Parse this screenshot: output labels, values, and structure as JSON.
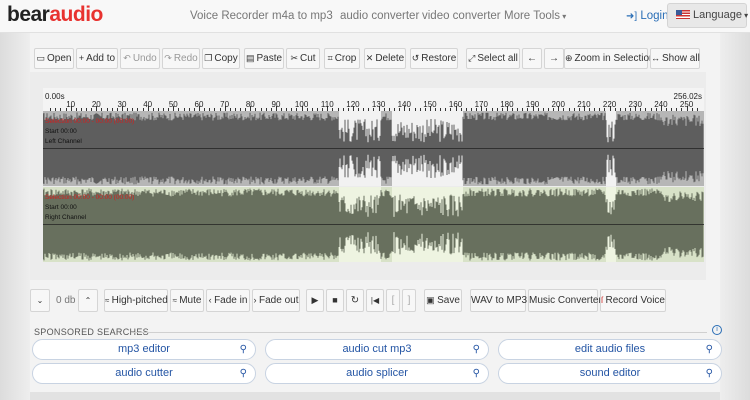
{
  "logo": {
    "part1": "bear",
    "part2": "audio"
  },
  "nav": {
    "items": [
      "Voice Recorder",
      "m4a to mp3",
      "audio converter",
      "video converter",
      "More Tools"
    ],
    "login": "Login",
    "language": "Language"
  },
  "toolbar": {
    "buttons": [
      "Open",
      "Add to",
      "Undo",
      "Redo",
      "Copy",
      "Paste",
      "Cut",
      "Crop",
      "Delete",
      "Restore",
      "Select all",
      "",
      "",
      "Zoom in Selection",
      "Show all"
    ]
  },
  "ruler": {
    "start": "0.00s",
    "end": "256.02s",
    "labels": [
      "10",
      "20",
      "30",
      "40",
      "50",
      "60",
      "70",
      "80",
      "90",
      "100",
      "110",
      "120",
      "130",
      "140",
      "150",
      "160",
      "170",
      "180",
      "190",
      "200",
      "210",
      "220",
      "230",
      "240",
      "250"
    ]
  },
  "channels": {
    "left": {
      "selection": "Selection 00:00 - 00:00 (00:00)",
      "start": "Start 00:00",
      "name": "Left Channel"
    },
    "right": {
      "selection": "Selection 00:00 - 00:00 (00:00)",
      "start": "Start 00:00",
      "name": "Right Channel"
    }
  },
  "controls": {
    "db": "0 db",
    "high_pitched": "High-pitched",
    "mute": "Mute",
    "fade_in": "Fade in",
    "fade_out": "Fade out",
    "save": "Save",
    "wav_to_mp3": "WAV to MP3",
    "music_converter": "Music Converter",
    "record_voice": "Record Voice"
  },
  "sponsored": {
    "title": "SPONSORED SEARCHES",
    "items": [
      "mp3 editor",
      "audio cut mp3",
      "edit audio files",
      "audio cutter",
      "audio splicer",
      "sound editor"
    ]
  },
  "colors": {
    "brand_red": "#e8322f",
    "link_blue": "#2a6eb6",
    "wave_left": "#5e5e5e",
    "wave_right": "#68705e",
    "highlight_left": "#f2f2f2",
    "highlight_right": "#eef4e1"
  },
  "icons": {
    "open": "folder-icon",
    "add": "plus-icon",
    "undo": "undo-icon",
    "redo": "redo-icon",
    "copy": "copy-icon",
    "paste": "paste-icon",
    "cut": "scissors-icon",
    "crop": "crop-icon",
    "delete": "x-icon",
    "restore": "restore-icon",
    "select_all": "expand-icon",
    "left": "arrow-left-icon",
    "right": "arrow-right-icon",
    "zoom": "zoom-in-icon",
    "show_all": "arrows-horizontal-icon"
  }
}
